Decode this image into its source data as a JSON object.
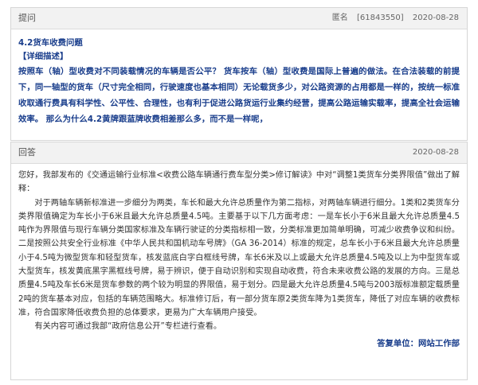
{
  "question": {
    "header_label": "提问",
    "anonymous": "匿名",
    "id": "[61843550]",
    "date": "2020-08-28",
    "title": "4.2货车收费问题",
    "detail_label": "【详细描述】",
    "body": "按照车（轴）型收费对不同装载情况的车辆是否公平？      货车按车（轴）型收费是国际上普遍的做法。在合法装载的前提下，同一轴型的货车（尺寸完全相同，行驶速度也基本相同）无论载货多少，对公路资源的占用都是一样的，按统一标准收取通行费具有科学性、公平性、合理性，也有利于促进公路货运行业集约经营，提高公路运输实载率，提高全社会运输效率。   那么为什么4.2黄牌跟蓝牌收费相差那么多，而不是一样呢，"
  },
  "answer": {
    "header_label": "回答",
    "date": "2020-08-28",
    "greeting": "您好，我部发布的《交通运输行业标准<收费公路车辆通行费车型分类>修订解读》中对“调整1类货车分类界限值”做出了解释：",
    "paragraph1": "对于两轴车辆新标准进一步细分为两类，车长和最大允许总质量作为第二指标，对两轴车辆进行细分。1类和2类货车分类界限值确定为车长小于6米且最大允许总质量4.5吨。主要基于以下几方面考虑：一是车长小于6米且最大允许总质量4.5吨作为界限值与现行车辆分类国家标准及车辆行驶证的分类指标相一致，分类标准更加简单明确，可减少收费争议和纠纷。二是按照公共安全行业标准《中华人民共和国机动车号牌》（GA 36-2014）标准的规定，总车长小于6米且最大允许总质量小于4.5吨为微型货车和轻型货车，核发蓝底白字白框线号牌，车长6米及以上或最大允许总质量4.5吨及以上为中型货车或大型货车，核发黄底黑字黑框线号牌，易于辨识，便于自动识别和实现自动收费，符合未来收费公路的发展的方向。三是总质量4.5吨及车长6米是货车参数的两个较为明显的界限值，易于划分。四是最大允许总质量4.5吨与2003版标准额定载质量2吨的货车基本对应，包括的车辆范围略大。标准修订后，有一部分货车原2类货车降为1类货车，降低了对应车辆的收费标准，符合国家降低收费负担的总体要求，更易为广大车辆用户接受。",
    "paragraph2": "有关内容可通过我部“政府信息公开”专栏进行查看。",
    "reply_unit": "答复单位：网站工作部"
  }
}
